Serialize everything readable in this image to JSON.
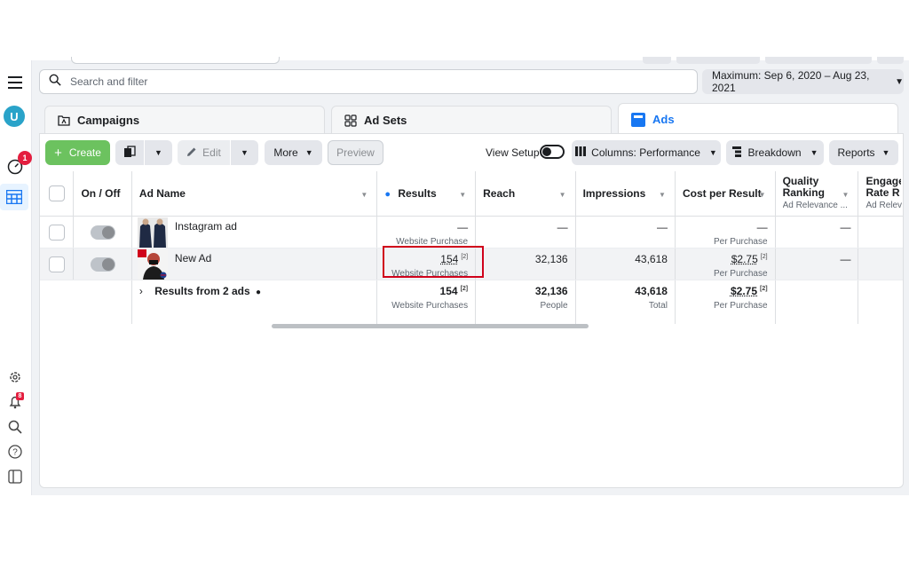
{
  "search": {
    "placeholder": "Search and filter"
  },
  "date_range": {
    "label": "Maximum: Sep 6, 2020 – Aug 23, 2021"
  },
  "tabs": [
    {
      "label": "Campaigns"
    },
    {
      "label": "Ad Sets"
    },
    {
      "label": "Ads"
    }
  ],
  "sidebar": {
    "avatar_initial": "U",
    "notification_count": "1",
    "alert_count": "8"
  },
  "toolbar": {
    "create_label": "Create",
    "edit_label": "Edit",
    "more_label": "More",
    "preview_label": "Preview",
    "view_setup_label": "View Setup",
    "columns_label": "Columns: Performance",
    "breakdown_label": "Breakdown",
    "reports_label": "Reports"
  },
  "table": {
    "headers": {
      "on_off": "On / Off",
      "ad_name": "Ad Name",
      "results": "Results",
      "reach": "Reach",
      "impressions": "Impressions",
      "cost_per_result": "Cost per Result",
      "quality_ranking": "Quality Ranking",
      "quality_sub": "Ad Relevance ...",
      "engagement": "Engage Rate R",
      "engagement_sub": "Ad Relev"
    },
    "rows": [
      {
        "name": "Instagram ad",
        "results": "—",
        "results_sub": "Website Purchase",
        "reach": "—",
        "impressions": "—",
        "cost": "—",
        "cost_sub": "Per Purchase",
        "quality": "—"
      },
      {
        "name": "New Ad",
        "results": "154",
        "results_note": "[2]",
        "results_sub": "Website Purchases",
        "reach": "32,136",
        "impressions": "43,618",
        "cost": "$2.75",
        "cost_note": "[2]",
        "cost_sub": "Per Purchase",
        "quality": "—"
      }
    ],
    "totals": {
      "label": "Results from 2 ads",
      "results": "154",
      "results_note": "[2]",
      "results_sub": "Website Purchases",
      "reach": "32,136",
      "reach_sub": "People",
      "impressions": "43,618",
      "impressions_sub": "Total",
      "cost": "$2.75",
      "cost_note": "[2]",
      "cost_sub": "Per Purchase"
    }
  }
}
